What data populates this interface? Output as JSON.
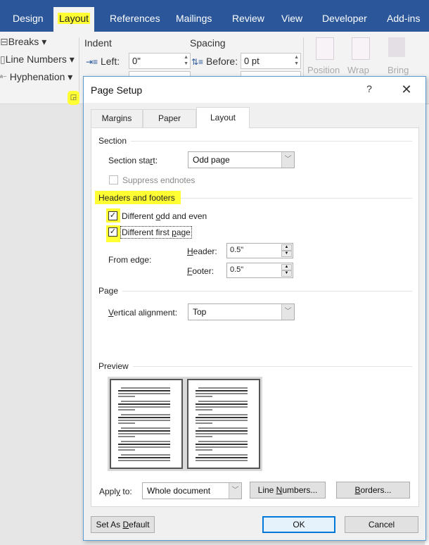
{
  "ribbon_tabs": [
    {
      "label": "Design"
    },
    {
      "label": "Layout",
      "active": true,
      "highlighted": true
    },
    {
      "label": "References"
    },
    {
      "label": "Mailings"
    },
    {
      "label": "Review"
    },
    {
      "label": "View"
    },
    {
      "label": "Developer"
    },
    {
      "label": "Add-ins"
    }
  ],
  "ribbon": {
    "breaks": "Breaks ▾",
    "line_numbers": "Line Numbers ▾",
    "hyphenation": "Hyphenation ▾",
    "indent_label": "Indent",
    "indent_left_label": "Left:",
    "indent_left_value": "0\"",
    "spacing_label": "Spacing",
    "spacing_before_label": "Before:",
    "spacing_before_value": "0 pt",
    "position": "Position",
    "wrap": "Wrap",
    "bring": "Bring",
    "launcher_icon": "dialog-launcher-icon"
  },
  "dialog": {
    "title": "Page Setup",
    "help": "?",
    "close": "✕",
    "tabs": [
      {
        "label": "Margins"
      },
      {
        "label": "Paper"
      },
      {
        "label": "Layout",
        "active": true
      }
    ],
    "section": {
      "group_label": "Section",
      "section_start_label_pre": "Section sta",
      "section_start_label_u": "r",
      "section_start_label_post": "t:",
      "section_start_value": "Odd page",
      "suppress_endnotes_label": "Suppress endnotes",
      "suppress_endnotes_checked": false,
      "suppress_endnotes_enabled": false
    },
    "headers_footers": {
      "group_label": "Headers and footers",
      "odd_even_pre": "Different ",
      "odd_even_u": "o",
      "odd_even_post": "dd and even",
      "odd_even_checked": true,
      "first_page_pre": "Different first ",
      "first_page_u": "p",
      "first_page_post": "age",
      "first_page_checked": true,
      "from_edge_label": "From edge:",
      "header_label_u": "H",
      "header_label_post": "eader:",
      "header_value": "0.5\"",
      "footer_label_u": "F",
      "footer_label_post": "ooter:",
      "footer_value": "0.5\""
    },
    "page": {
      "group_label": "Page",
      "vertical_alignment_u": "V",
      "vertical_alignment_post": "ertical alignment:",
      "vertical_alignment_value": "Top"
    },
    "preview": {
      "group_label": "Preview"
    },
    "apply_to": {
      "label_pre": "Appl",
      "label_u": "y",
      "label_post": " to:",
      "value": "Whole document"
    },
    "buttons": {
      "line_numbers_pre": "Line ",
      "line_numbers_u": "N",
      "line_numbers_post": "umbers...",
      "borders_u": "B",
      "borders_post": "orders...",
      "set_default_pre": "Set As ",
      "set_default_u": "D",
      "set_default_post": "efault",
      "ok": "OK",
      "cancel": "Cancel"
    }
  }
}
